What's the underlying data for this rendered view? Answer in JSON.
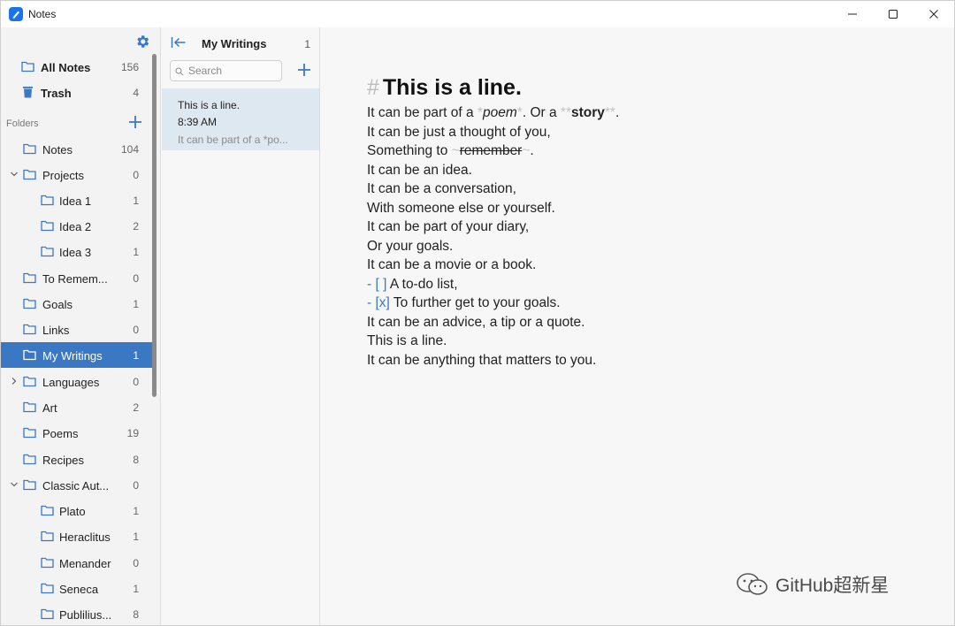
{
  "app": {
    "title": "Notes"
  },
  "sidebar": {
    "all_notes": {
      "label": "All Notes",
      "count": "156"
    },
    "trash": {
      "label": "Trash",
      "count": "4"
    },
    "folders_header": "Folders",
    "folders": [
      {
        "label": "Notes",
        "count": "104"
      },
      {
        "label": "Projects",
        "count": "0"
      },
      {
        "label": "Idea 1",
        "count": "1"
      },
      {
        "label": "Idea 2",
        "count": "2"
      },
      {
        "label": "Idea 3",
        "count": "1"
      },
      {
        "label": "To Remem...",
        "count": "0"
      },
      {
        "label": "Goals",
        "count": "1"
      },
      {
        "label": "Links",
        "count": "0"
      },
      {
        "label": "My Writings",
        "count": "1"
      },
      {
        "label": "Languages",
        "count": "0"
      },
      {
        "label": "Art",
        "count": "2"
      },
      {
        "label": "Poems",
        "count": "19"
      },
      {
        "label": "Recipes",
        "count": "8"
      },
      {
        "label": "Classic Aut...",
        "count": "0"
      },
      {
        "label": "Plato",
        "count": "1"
      },
      {
        "label": "Heraclitus",
        "count": "1"
      },
      {
        "label": "Menander",
        "count": "0"
      },
      {
        "label": "Seneca",
        "count": "1"
      },
      {
        "label": "Publilius...",
        "count": "8"
      }
    ]
  },
  "notelist": {
    "title": "My Writings",
    "count": "1",
    "search_placeholder": "Search",
    "notes": [
      {
        "title": "This is a line.",
        "time": "8:39 AM",
        "preview": "It can be part of a *po..."
      }
    ]
  },
  "editor": {
    "heading_marker": "#",
    "heading": "This is a line.",
    "line1": {
      "a": "It can be part of a ",
      "em_open": "*",
      "em": "poem",
      "em_close": "*",
      "b": ". Or a ",
      "strong_open": "**",
      "strong": "story",
      "strong_close": "**",
      "c": "."
    },
    "line2": "It can be just a thought of you,",
    "line3": {
      "a": "Something to ",
      "open": "~",
      "strike": "remember",
      "close": "~",
      "c": "."
    },
    "line4": "It can be an idea.",
    "line5": "It can be a conversation,",
    "line6": "With someone else or yourself.",
    "line7": "It can be part of your diary,",
    "line8": "Or your goals.",
    "line9": "It can be a movie or a book.",
    "todo1": {
      "marker": "- [ ]",
      "text": "A to-do list,"
    },
    "todo2": {
      "marker": "- [x]",
      "text": "To further get to your goals."
    },
    "line12": "It can be an advice, a tip or a quote.",
    "line13": "This is a line.",
    "line14": "It can be anything that matters to you."
  },
  "watermark": {
    "text": "GitHub超新星"
  },
  "colors": {
    "accent": "#3a78c3",
    "selected_note": "#dde8f1"
  }
}
